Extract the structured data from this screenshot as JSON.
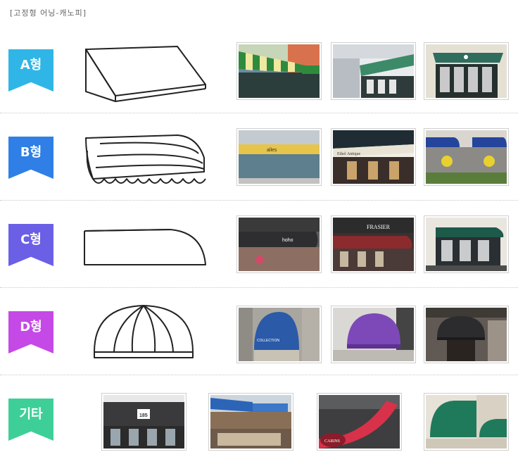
{
  "header": {
    "title": "[고정형 어닝-캐노피]"
  },
  "rows": [
    {
      "label": "A형",
      "color": "#2fb6e6"
    },
    {
      "label": "B형",
      "color": "#2f7fe6"
    },
    {
      "label": "C형",
      "color": "#6b5fe6"
    },
    {
      "label": "D형",
      "color": "#c449e6"
    },
    {
      "label": "기타",
      "color": "#3ecf98"
    }
  ],
  "photo_texts": {
    "b1_sign": "alles",
    "b2_sign": "Ethel Antique",
    "c1_sign": "hoho",
    "c2_sign": "FRASIER",
    "d1_sign": "COLLECTION",
    "e1_sign": "185",
    "e3_sign": "CARINS"
  }
}
